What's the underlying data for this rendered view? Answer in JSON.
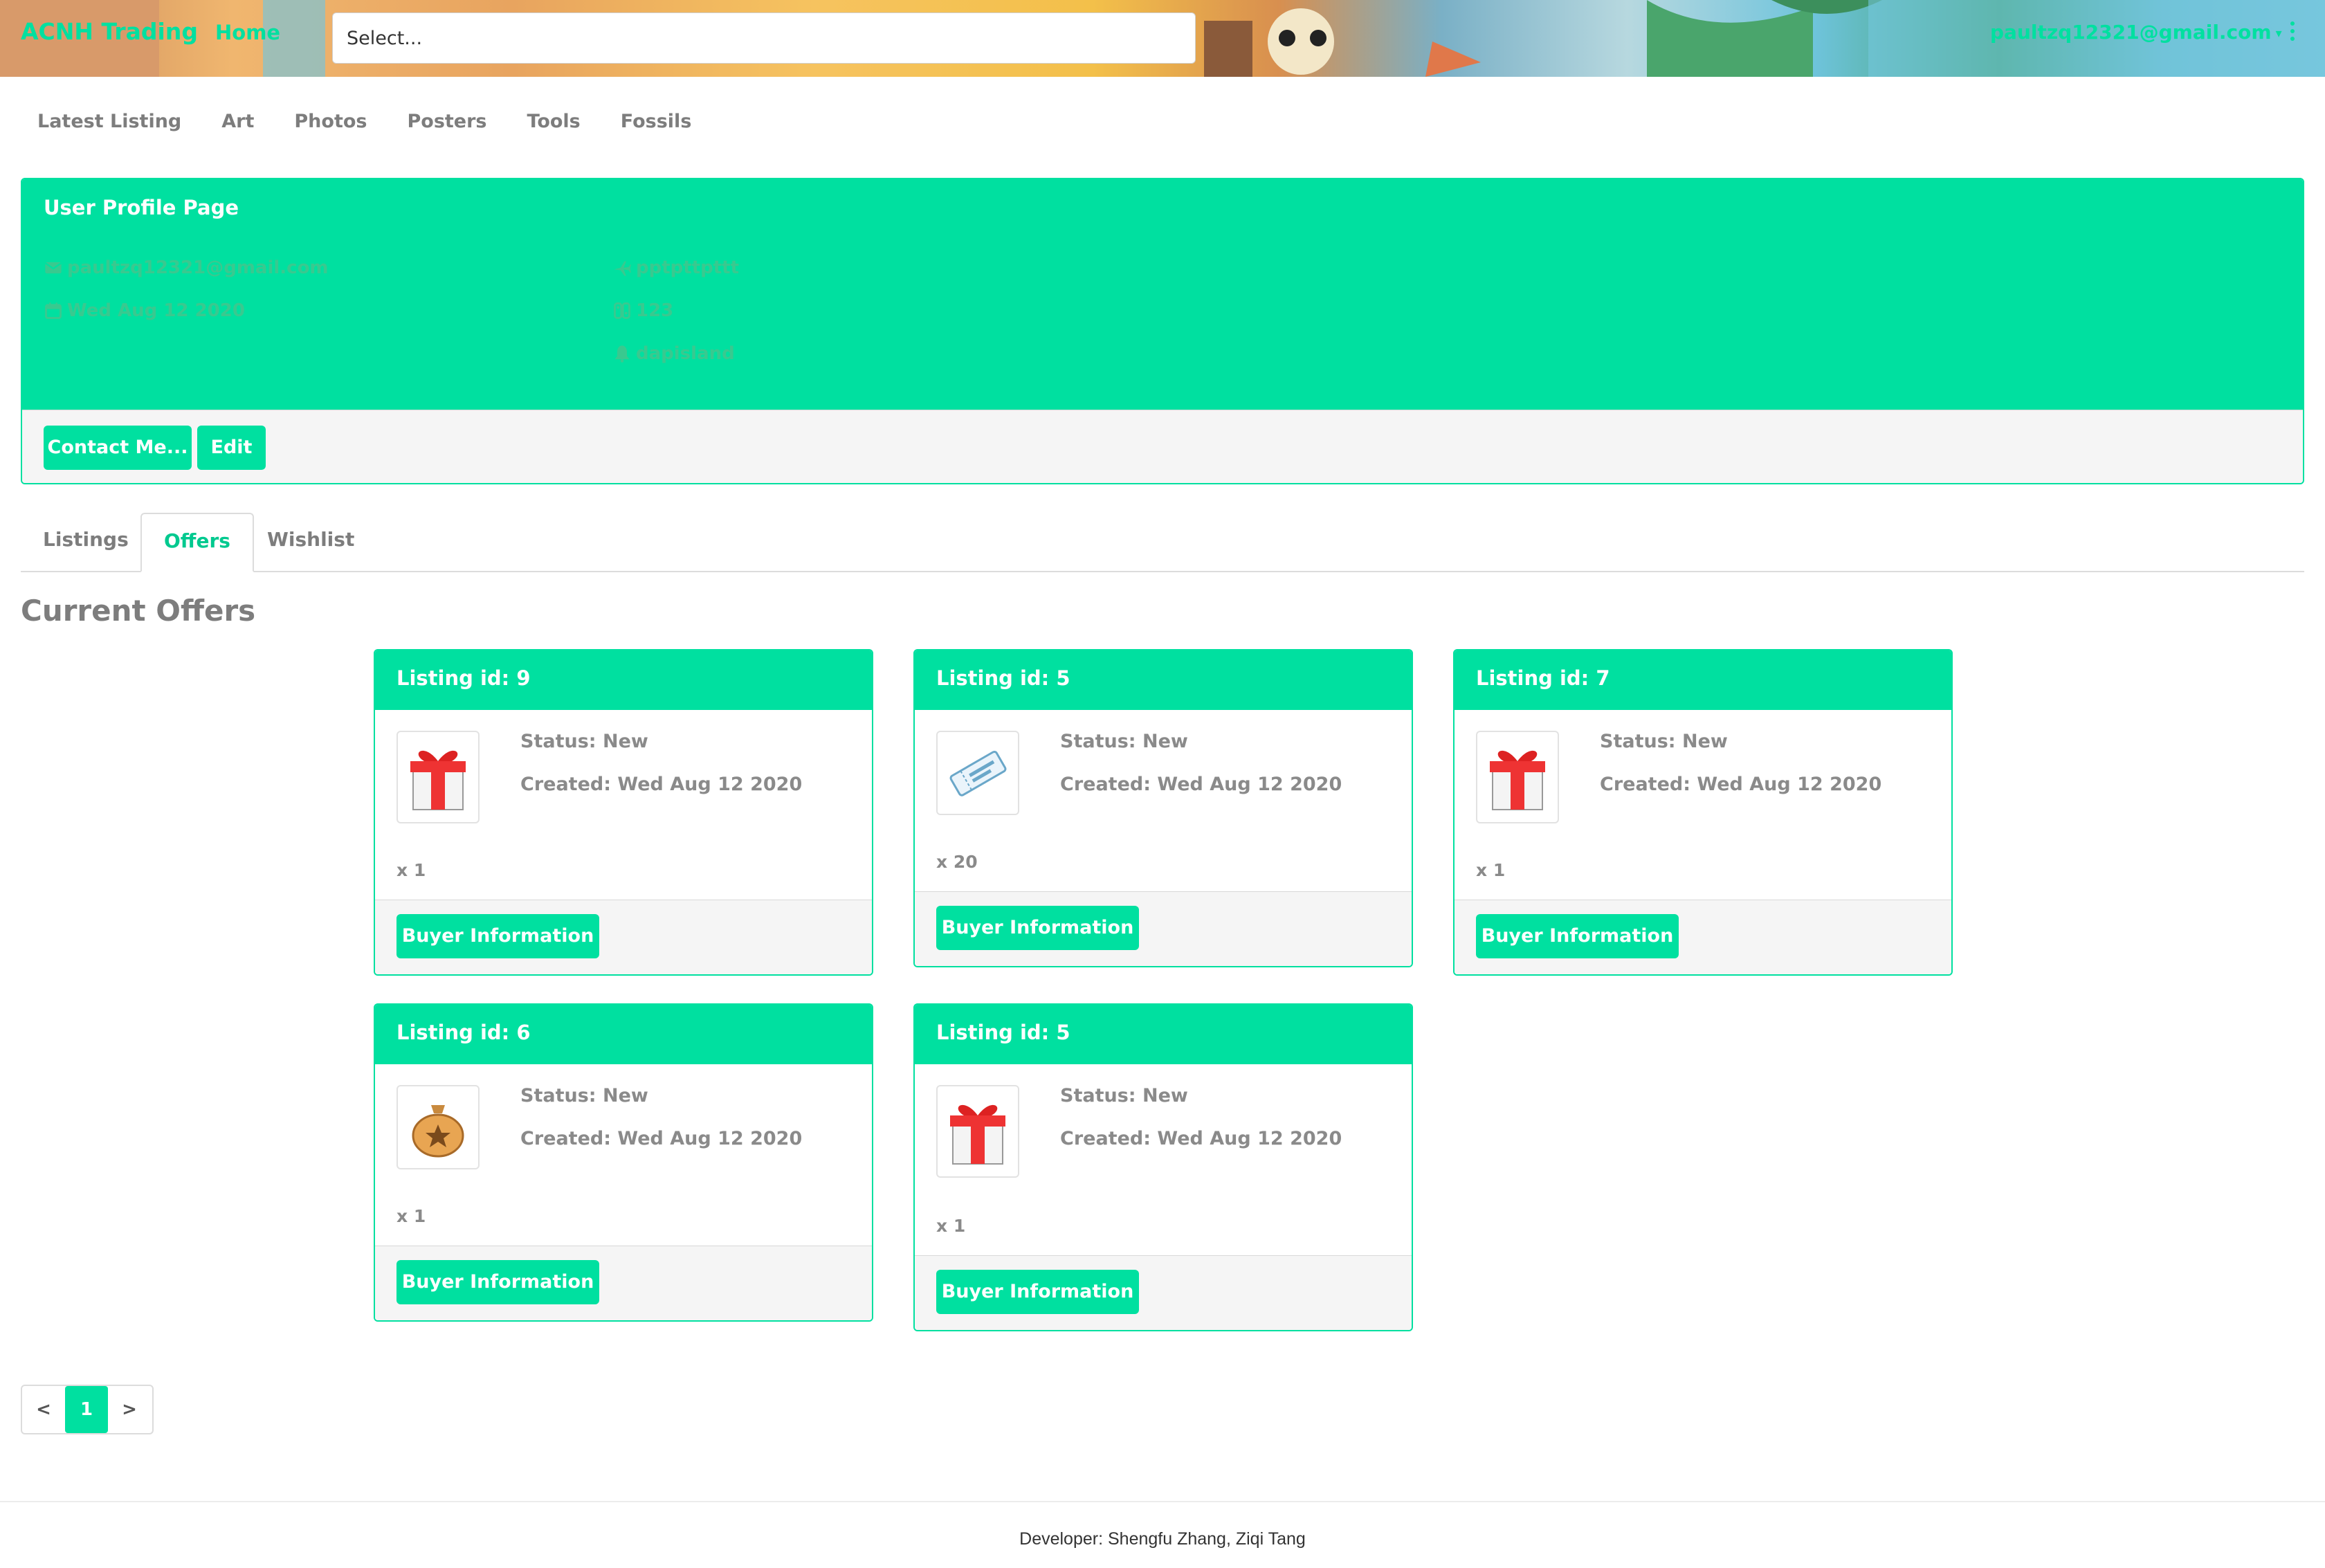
{
  "navbar": {
    "brand": "ACNH Trading",
    "home": "Home",
    "search_placeholder": "Select...",
    "user_email": "paultzq12321@gmail.com",
    "menu_icon": "kebab-menu-icon",
    "accent": "#00e0a0"
  },
  "categories": [
    "Latest Listing",
    "Art",
    "Photos",
    "Posters",
    "Tools",
    "Fossils"
  ],
  "profile": {
    "title": "User Profile Page",
    "email": "paultzq12321@gmail.com",
    "joined": "Wed Aug 12 2020",
    "username": "pptpttpttt",
    "switch_id": "123",
    "island": "dapisland",
    "contact_button": "Contact Me...",
    "edit_button": "Edit"
  },
  "tabs": [
    {
      "label": "Listings",
      "active": false
    },
    {
      "label": "Offers",
      "active": true
    },
    {
      "label": "Wishlist",
      "active": false
    }
  ],
  "section_title": "Current Offers",
  "offers": [
    {
      "title": "Listing id: 9",
      "status": "Status: New",
      "created": "Created: Wed Aug 12 2020",
      "quantity": "x 1",
      "icon": "gift-icon",
      "button": "Buyer Information"
    },
    {
      "title": "Listing id: 5",
      "status": "Status: New",
      "created": "Created: Wed Aug 12 2020",
      "quantity": "x 20",
      "icon": "ticket-icon",
      "button": "Buyer Information"
    },
    {
      "title": "Listing id: 7",
      "status": "Status: New",
      "created": "Created: Wed Aug 12 2020",
      "quantity": "x 1",
      "icon": "gift-icon",
      "button": "Buyer Information"
    },
    {
      "title": "Listing id: 6",
      "status": "Status: New",
      "created": "Created: Wed Aug 12 2020",
      "quantity": "x 1",
      "icon": "bell-bag-icon",
      "button": "Buyer Information"
    },
    {
      "title": "Listing id: 5",
      "status": "Status: New",
      "created": "Created: Wed Aug 12 2020",
      "quantity": "x 1",
      "icon": "gift-icon",
      "button": "Buyer Information"
    }
  ],
  "pagination": {
    "prev": "<",
    "current": "1",
    "next": ">"
  },
  "footer": "Developer: Shengfu Zhang, Ziqi Tang"
}
